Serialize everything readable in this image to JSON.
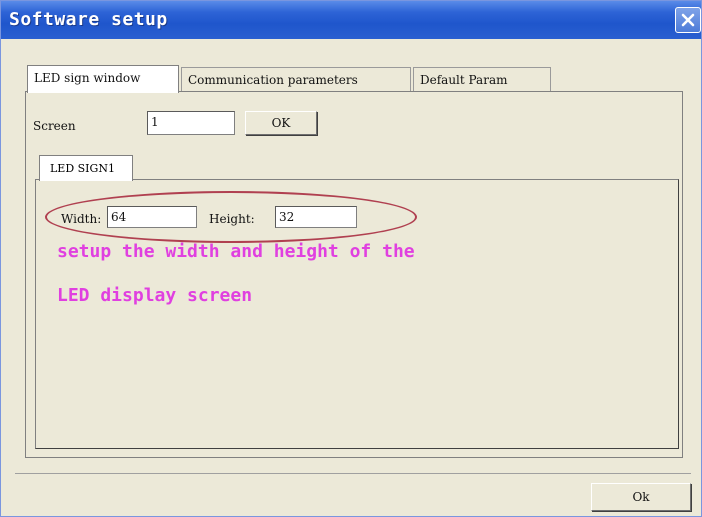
{
  "window": {
    "title": "Software setup",
    "close_icon": "close-icon"
  },
  "tabs": [
    {
      "label": "LED sign window",
      "active": true
    },
    {
      "label": "Communication parameters",
      "active": false
    },
    {
      "label": "Default Param",
      "active": false
    }
  ],
  "screen": {
    "label": "Screen",
    "value": "1",
    "ok_label": "OK"
  },
  "sign_tabs": [
    {
      "label": "LED SIGN1",
      "active": true
    }
  ],
  "dimensions": {
    "width_label": "Width:",
    "width_value": "64",
    "height_label": "Height:",
    "height_value": "32"
  },
  "annotation": {
    "line1": "setup the width and height of the",
    "line2": "LED display screen",
    "color": "#e040e0",
    "highlight_color": "#b04050"
  },
  "footer": {
    "ok_label": "Ok"
  }
}
